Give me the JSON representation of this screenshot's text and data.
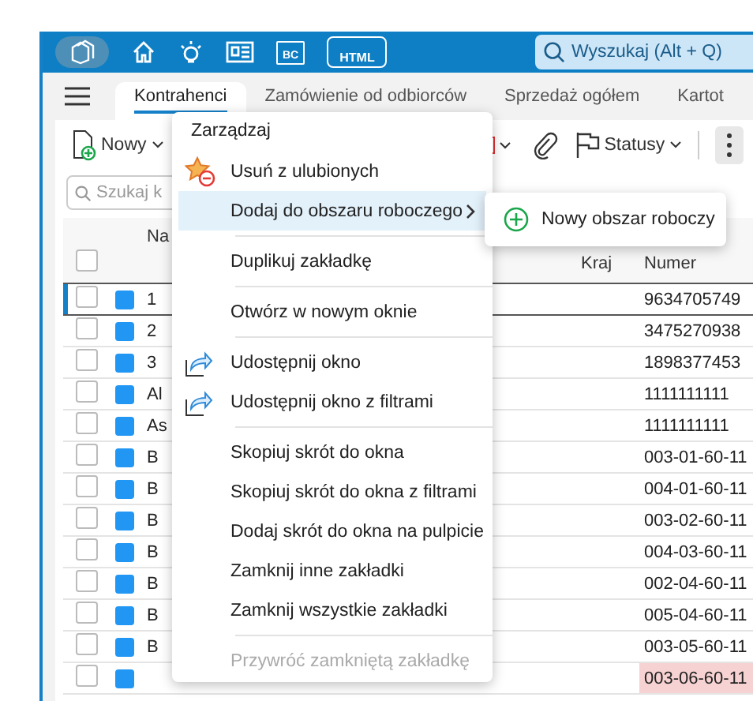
{
  "topbar": {
    "badges": [
      "BC",
      "HTML"
    ],
    "search": {
      "placeholder": "Wyszukaj (Alt + Q)"
    }
  },
  "tabs": [
    {
      "label": "Kontrahenci",
      "selected": true
    },
    {
      "label": "Zamówienie od odbiorców",
      "selected": false
    },
    {
      "label": "Sprzedaż ogółem",
      "selected": false
    },
    {
      "label": "Kartot",
      "selected": false
    }
  ],
  "toolbar": {
    "new_button": "Nowy",
    "status_button": "Statusy"
  },
  "filter": {
    "placeholder": "Szukaj k"
  },
  "table": {
    "columns": [
      "Na",
      "Kraj",
      "Numer"
    ],
    "all_checked": false,
    "rows": [
      {
        "name": "1",
        "number": "9634705749",
        "selected": true,
        "checked": false,
        "alert": false
      },
      {
        "name": "2",
        "number": "3475270938",
        "selected": false,
        "checked": false,
        "alert": false
      },
      {
        "name": "3",
        "number": "1898377453",
        "selected": false,
        "checked": false,
        "alert": false
      },
      {
        "name": "Al",
        "number": "1111111111",
        "selected": false,
        "checked": false,
        "alert": false
      },
      {
        "name": "As",
        "number": "1111111111",
        "selected": false,
        "checked": false,
        "alert": false
      },
      {
        "name": "B",
        "number": "003-01-60-11",
        "selected": false,
        "checked": false,
        "alert": false
      },
      {
        "name": "B",
        "number": "004-01-60-11",
        "selected": false,
        "checked": false,
        "alert": false
      },
      {
        "name": "B",
        "number": "003-02-60-11",
        "selected": false,
        "checked": false,
        "alert": false
      },
      {
        "name": "B",
        "number": "004-03-60-11",
        "selected": false,
        "checked": false,
        "alert": false
      },
      {
        "name": "B",
        "number": "002-04-60-11",
        "selected": false,
        "checked": false,
        "alert": false
      },
      {
        "name": "B",
        "number": "005-04-60-11",
        "selected": false,
        "checked": false,
        "alert": false
      },
      {
        "name": "B",
        "number": "003-05-60-11",
        "selected": false,
        "checked": false,
        "alert": false
      },
      {
        "number": "003-06-60-11",
        "selected": false,
        "checked": false,
        "alert": true
      }
    ]
  },
  "menu": {
    "title": "Zarządzaj",
    "groups": [
      [
        {
          "label": "Usuń z ulubionych",
          "kind": "favorite",
          "selected": false,
          "disabled": false
        },
        {
          "label": "Dodaj do obszaru roboczego",
          "kind": "submenu",
          "selected": true,
          "disabled": false
        }
      ],
      [
        {
          "label": "Duplikuj zakładkę",
          "kind": "plain",
          "selected": false,
          "disabled": false
        }
      ],
      [
        {
          "label": "Otwórz w nowym oknie",
          "kind": "plain",
          "selected": false,
          "disabled": false
        }
      ],
      [
        {
          "label": "Udostępnij okno",
          "kind": "share",
          "selected": false,
          "disabled": false
        },
        {
          "label": "Udostępnij okno z filtrami",
          "kind": "share",
          "selected": false,
          "disabled": false
        }
      ],
      [
        {
          "label": "Skopiuj skrót do okna",
          "kind": "plain",
          "selected": false,
          "disabled": false
        },
        {
          "label": "Skopiuj skrót do okna z filtrami",
          "kind": "plain",
          "selected": false,
          "disabled": false
        },
        {
          "label": "Dodaj skrót do okna na pulpicie",
          "kind": "plain",
          "selected": false,
          "disabled": false
        },
        {
          "label": "Zamknij inne zakładki",
          "kind": "plain",
          "selected": false,
          "disabled": false
        },
        {
          "label": "Zamknij wszystkie zakładki",
          "kind": "plain",
          "selected": false,
          "disabled": false
        }
      ],
      [
        {
          "label": "Przywróć zamkniętą zakładkę",
          "kind": "plain",
          "selected": false,
          "disabled": true
        }
      ]
    ]
  },
  "submenu": {
    "items": [
      {
        "label": "Nowy obszar roboczy"
      }
    ]
  }
}
